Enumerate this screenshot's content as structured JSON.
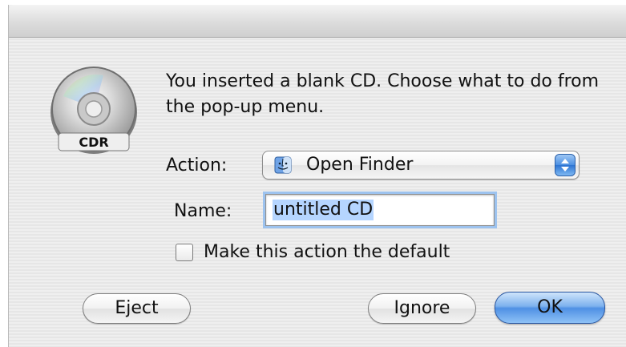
{
  "dialog": {
    "icon": "cd-icon",
    "icon_label": "CDR",
    "message": "You inserted a blank CD. Choose what to do from the pop-up menu.",
    "action_label": "Action:",
    "action_popup": {
      "selected": "Open Finder",
      "icon": "finder-icon"
    },
    "name_label": "Name:",
    "name_field": {
      "value": "untitled CD"
    },
    "default_checkbox": {
      "label": "Make this action the default",
      "checked": false
    },
    "buttons": {
      "eject": "Eject",
      "ignore": "Ignore",
      "ok": "OK"
    }
  },
  "colors": {
    "accent_blue": "#4f90e4",
    "selection": "#b5d5ff"
  }
}
